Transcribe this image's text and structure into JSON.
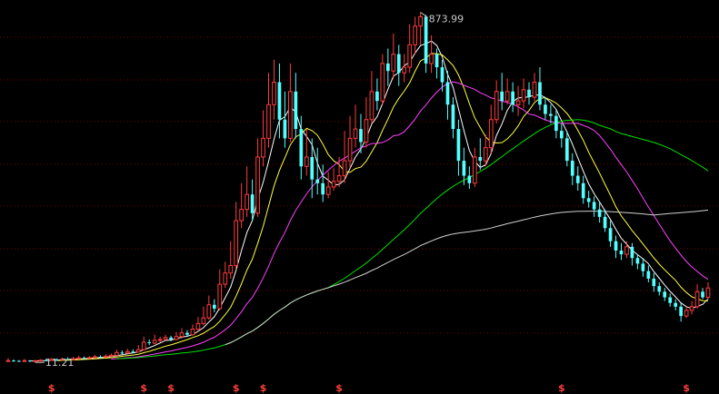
{
  "chart_data": {
    "type": "candlestick",
    "title": "",
    "xlabel": "",
    "ylabel": "",
    "grid": true,
    "ylim": [
      -60,
      1920
    ],
    "annotations": {
      "high_label": "873.99",
      "low_label": "11.21",
      "high_value": 1873.99,
      "low_value": 11.21
    },
    "marker_symbol": "$",
    "marker_bars": [
      8,
      25,
      30,
      42,
      47,
      61,
      102,
      125,
      143
    ],
    "colors": {
      "up": "#ff3c3c",
      "down": "#54ffff",
      "grid": "#7a0000",
      "marker": "#ff3c3c",
      "label": "#c8c8c8",
      "ma_white": "#ffffff",
      "ma_yellow": "#ffff40",
      "ma_magenta": "#ff40ff",
      "ma_green": "#00e000",
      "ma_gray": "#d0d0d0"
    },
    "candles": [
      [
        8,
        12,
        7,
        25
      ],
      [
        12,
        10,
        5,
        18
      ],
      [
        10,
        9,
        6,
        15
      ],
      [
        9,
        12,
        7,
        20
      ],
      [
        12,
        8,
        4,
        15
      ],
      [
        8,
        11.21,
        2,
        16
      ],
      [
        11,
        14,
        9,
        20
      ],
      [
        14,
        13,
        9,
        22
      ],
      [
        13,
        18,
        10,
        26
      ],
      [
        18,
        15,
        11,
        24
      ],
      [
        15,
        20,
        12,
        28
      ],
      [
        20,
        18,
        14,
        30
      ],
      [
        18,
        22,
        15,
        32
      ],
      [
        22,
        26,
        18,
        38
      ],
      [
        26,
        24,
        20,
        34
      ],
      [
        24,
        28,
        22,
        36
      ],
      [
        28,
        32,
        25,
        42
      ],
      [
        32,
        30,
        26,
        40
      ],
      [
        30,
        35,
        28,
        46
      ],
      [
        35,
        40,
        30,
        50
      ],
      [
        40,
        55,
        36,
        70
      ],
      [
        55,
        52,
        45,
        66
      ],
      [
        52,
        60,
        48,
        75
      ],
      [
        60,
        58,
        52,
        72
      ],
      [
        58,
        70,
        55,
        95
      ],
      [
        70,
        110,
        65,
        140
      ],
      [
        110,
        105,
        95,
        125
      ],
      [
        105,
        120,
        100,
        150
      ],
      [
        120,
        125,
        110,
        140
      ],
      [
        125,
        135,
        118,
        150
      ],
      [
        135,
        125,
        115,
        145
      ],
      [
        125,
        140,
        120,
        165
      ],
      [
        140,
        160,
        130,
        185
      ],
      [
        160,
        150,
        140,
        175
      ],
      [
        150,
        180,
        145,
        205
      ],
      [
        180,
        210,
        170,
        245
      ],
      [
        210,
        240,
        200,
        300
      ],
      [
        240,
        310,
        230,
        360
      ],
      [
        310,
        290,
        270,
        340
      ],
      [
        290,
        420,
        280,
        500
      ],
      [
        420,
        480,
        400,
        540
      ],
      [
        480,
        520,
        450,
        650
      ],
      [
        520,
        760,
        500,
        860
      ],
      [
        760,
        820,
        720,
        960
      ],
      [
        820,
        900,
        780,
        1050
      ],
      [
        900,
        800,
        760,
        980
      ],
      [
        800,
        1100,
        780,
        1200
      ],
      [
        1100,
        1200,
        1050,
        1350
      ],
      [
        1200,
        1380,
        1150,
        1550
      ],
      [
        1380,
        1500,
        1300,
        1620
      ],
      [
        1500,
        1300,
        1200,
        1600
      ],
      [
        1300,
        1200,
        1150,
        1450
      ],
      [
        1200,
        1450,
        1180,
        1600
      ],
      [
        1450,
        1250,
        1200,
        1550
      ],
      [
        1250,
        1050,
        980,
        1320
      ],
      [
        1050,
        1100,
        1000,
        1250
      ],
      [
        1100,
        980,
        880,
        1200
      ],
      [
        980,
        960,
        900,
        1150
      ],
      [
        960,
        900,
        860,
        1060
      ],
      [
        900,
        940,
        880,
        1020
      ],
      [
        940,
        970,
        920,
        1040
      ],
      [
        970,
        1000,
        940,
        1100
      ],
      [
        1000,
        1080,
        960,
        1240
      ],
      [
        1080,
        1200,
        1040,
        1320
      ],
      [
        1200,
        1250,
        1150,
        1380
      ],
      [
        1250,
        1180,
        1120,
        1330
      ],
      [
        1180,
        1300,
        1150,
        1420
      ],
      [
        1300,
        1450,
        1280,
        1560
      ],
      [
        1450,
        1400,
        1350,
        1520
      ],
      [
        1400,
        1600,
        1380,
        1650
      ],
      [
        1600,
        1560,
        1480,
        1680
      ],
      [
        1560,
        1650,
        1520,
        1760
      ],
      [
        1650,
        1550,
        1480,
        1700
      ],
      [
        1550,
        1580,
        1500,
        1650
      ],
      [
        1580,
        1700,
        1550,
        1810
      ],
      [
        1700,
        1800,
        1650,
        1850
      ],
      [
        1800,
        1850,
        1700,
        1873.99
      ],
      [
        1850,
        1600,
        1550,
        1860
      ],
      [
        1600,
        1650,
        1550,
        1750
      ],
      [
        1650,
        1580,
        1520,
        1680
      ],
      [
        1580,
        1500,
        1450,
        1620
      ],
      [
        1500,
        1380,
        1300,
        1560
      ],
      [
        1380,
        1250,
        1200,
        1420
      ],
      [
        1250,
        1080,
        1000,
        1300
      ],
      [
        1080,
        1000,
        950,
        1150
      ],
      [
        1000,
        960,
        930,
        1050
      ],
      [
        960,
        1100,
        940,
        1150
      ],
      [
        1100,
        1080,
        1030,
        1200
      ],
      [
        1080,
        1150,
        1050,
        1220
      ],
      [
        1150,
        1300,
        1120,
        1380
      ],
      [
        1300,
        1450,
        1280,
        1510
      ],
      [
        1450,
        1400,
        1350,
        1550
      ],
      [
        1400,
        1450,
        1380,
        1520
      ],
      [
        1450,
        1380,
        1340,
        1500
      ],
      [
        1380,
        1400,
        1320,
        1480
      ],
      [
        1400,
        1460,
        1360,
        1520
      ],
      [
        1460,
        1420,
        1380,
        1500
      ],
      [
        1420,
        1500,
        1400,
        1550
      ],
      [
        1500,
        1380,
        1350,
        1580
      ],
      [
        1380,
        1330,
        1300,
        1420
      ],
      [
        1330,
        1320,
        1280,
        1380
      ],
      [
        1320,
        1240,
        1200,
        1350
      ],
      [
        1240,
        1200,
        1150,
        1280
      ],
      [
        1200,
        1080,
        1050,
        1240
      ],
      [
        1080,
        1000,
        950,
        1120
      ],
      [
        1000,
        960,
        920,
        1050
      ],
      [
        960,
        880,
        850,
        1000
      ],
      [
        880,
        860,
        830,
        920
      ],
      [
        860,
        820,
        780,
        890
      ],
      [
        820,
        780,
        750,
        860
      ],
      [
        780,
        720,
        700,
        820
      ],
      [
        720,
        650,
        620,
        760
      ],
      [
        650,
        600,
        560,
        680
      ],
      [
        600,
        580,
        550,
        640
      ],
      [
        580,
        620,
        560,
        650
      ],
      [
        620,
        560,
        520,
        640
      ],
      [
        560,
        530,
        500,
        580
      ],
      [
        530,
        490,
        460,
        560
      ],
      [
        490,
        450,
        430,
        520
      ],
      [
        450,
        410,
        380,
        480
      ],
      [
        410,
        380,
        360,
        430
      ],
      [
        380,
        350,
        330,
        400
      ],
      [
        350,
        320,
        300,
        370
      ],
      [
        320,
        300,
        280,
        340
      ],
      [
        300,
        250,
        220,
        320
      ],
      [
        250,
        280,
        240,
        300
      ],
      [
        280,
        300,
        260,
        330
      ],
      [
        300,
        380,
        290,
        420
      ],
      [
        380,
        350,
        340,
        400
      ],
      [
        350,
        400,
        340,
        430
      ]
    ],
    "moving_averages": [
      {
        "period": 5,
        "color_key": "ma_white",
        "start": 4
      },
      {
        "period": 10,
        "color_key": "ma_yellow",
        "start": 9
      },
      {
        "period": 20,
        "color_key": "ma_magenta",
        "start": 19
      },
      {
        "period": 60,
        "color_key": "ma_green",
        "start": 20
      },
      {
        "period": 120,
        "color_key": "ma_gray",
        "start": 40
      }
    ]
  }
}
